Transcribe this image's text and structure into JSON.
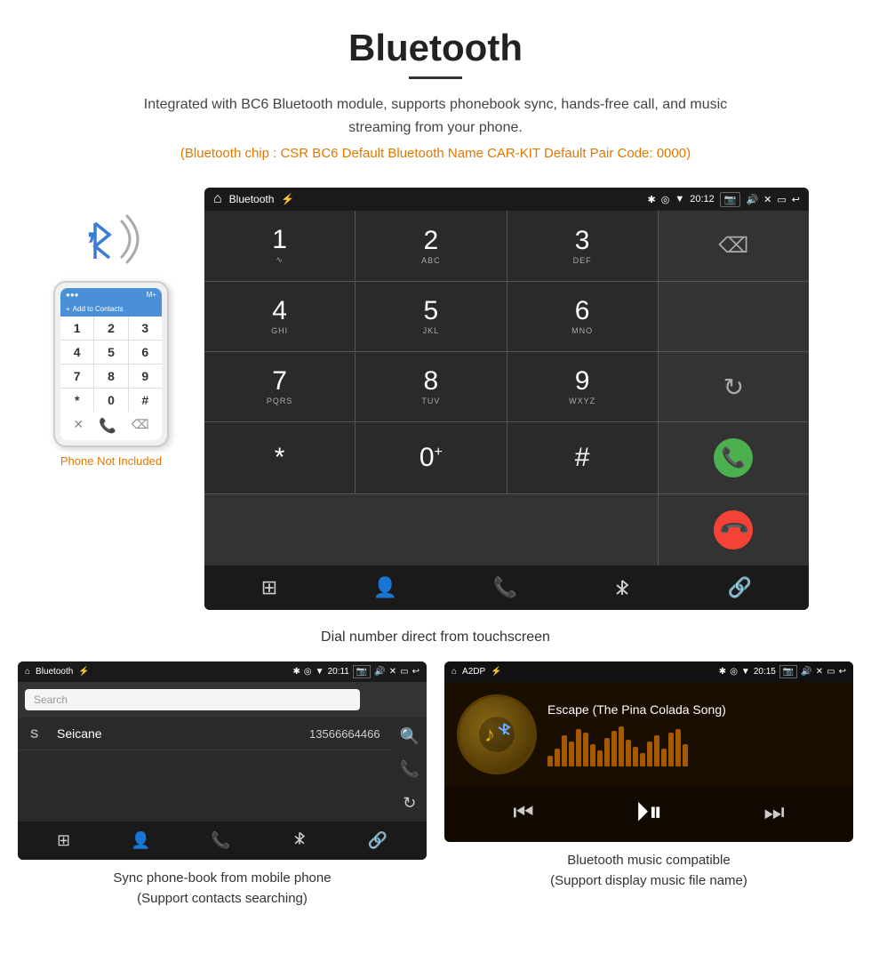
{
  "header": {
    "title": "Bluetooth",
    "description": "Integrated with BC6 Bluetooth module, supports phonebook sync, hands-free call, and music streaming from your phone.",
    "specs": "(Bluetooth chip : CSR BC6    Default Bluetooth Name CAR-KIT    Default Pair Code: 0000)"
  },
  "main_dialer": {
    "statusbar": {
      "screen_title": "Bluetooth",
      "time": "20:12",
      "icons": "usb bt loc signal cam vol x win back"
    },
    "keys": [
      {
        "num": "1",
        "sub": ""
      },
      {
        "num": "2",
        "sub": "ABC"
      },
      {
        "num": "3",
        "sub": "DEF"
      },
      {
        "num": "",
        "sub": "backspace"
      },
      {
        "num": "4",
        "sub": "GHI"
      },
      {
        "num": "5",
        "sub": "JKL"
      },
      {
        "num": "6",
        "sub": "MNO"
      },
      {
        "num": "",
        "sub": ""
      },
      {
        "num": "7",
        "sub": "PQRS"
      },
      {
        "num": "8",
        "sub": "TUV"
      },
      {
        "num": "9",
        "sub": "WXYZ"
      },
      {
        "num": "",
        "sub": "refresh"
      },
      {
        "num": "*",
        "sub": ""
      },
      {
        "num": "0",
        "sub": "+"
      },
      {
        "num": "#",
        "sub": ""
      },
      {
        "num": "",
        "sub": "call_green"
      },
      {
        "num": "",
        "sub": "call_red"
      }
    ],
    "nav_icons": [
      "grid",
      "person",
      "phone",
      "bluetooth",
      "link"
    ]
  },
  "dial_caption": "Dial number direct from touchscreen",
  "phonebook": {
    "statusbar_title": "Bluetooth",
    "statusbar_time": "20:11",
    "search_placeholder": "Search",
    "contact": {
      "letter": "S",
      "name": "Seicane",
      "number": "13566664466"
    },
    "caption_line1": "Sync phone-book from mobile phone",
    "caption_line2": "(Support contacts searching)"
  },
  "music": {
    "statusbar_title": "A2DP",
    "statusbar_time": "20:15",
    "song_title": "Escape (The Pina Colada Song)",
    "eq_bars": [
      12,
      20,
      35,
      28,
      42,
      38,
      25,
      18,
      32,
      40,
      45,
      30,
      22,
      15,
      28,
      35,
      20,
      38,
      42,
      25
    ],
    "caption_line1": "Bluetooth music compatible",
    "caption_line2": "(Support display music file name)"
  },
  "phone_label": "Phone Not Included",
  "colors": {
    "orange": "#e07800",
    "green": "#4caf50",
    "red": "#f44336",
    "blue": "#3a7bd5",
    "dark_bg": "#2a2a2a",
    "darker_bg": "#1a1a1a"
  }
}
